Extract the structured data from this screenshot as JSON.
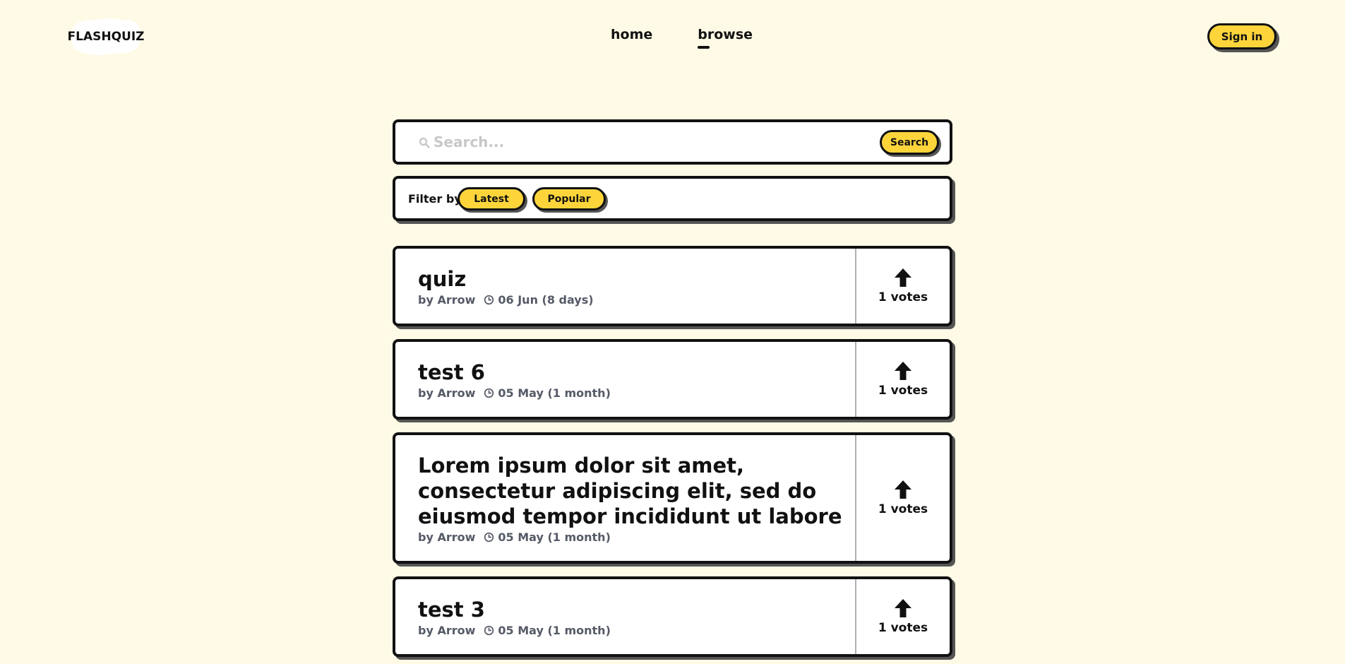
{
  "header": {
    "logo_text": "FLASHQUIZ",
    "nav": [
      {
        "label": "home",
        "active": false
      },
      {
        "label": "browse",
        "active": true
      }
    ],
    "signin_label": "Sign in"
  },
  "search": {
    "placeholder": "Search...",
    "value": "",
    "button_label": "Search",
    "icon": "search-icon"
  },
  "filter": {
    "label": "Filter by",
    "options": [
      "Latest",
      "Popular"
    ]
  },
  "colors": {
    "background": "#fffae6",
    "accent": "#fdd53b",
    "border": "#111111",
    "meta_text": "#555a66"
  },
  "quizzes": [
    {
      "title": "quiz",
      "author": "by Arrow",
      "date": "06 Jun (8 days)",
      "votes": "1 votes"
    },
    {
      "title": "test 6",
      "author": "by Arrow",
      "date": "05 May (1 month)",
      "votes": "1 votes"
    },
    {
      "title": "Lorem ipsum dolor sit amet, consectetur adipiscing elit, sed do eiusmod tempor incididunt ut labore",
      "author": "by Arrow",
      "date": "05 May (1 month)",
      "votes": "1 votes"
    },
    {
      "title": "test 3",
      "author": "by Arrow",
      "date": "05 May (1 month)",
      "votes": "1 votes"
    }
  ]
}
